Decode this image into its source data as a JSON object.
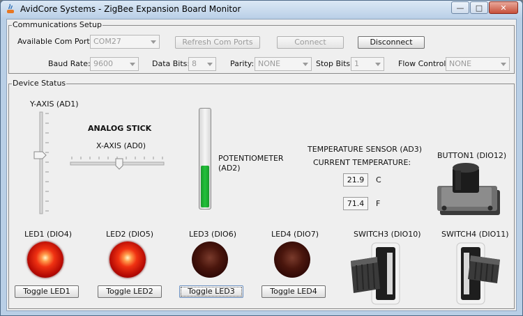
{
  "window": {
    "title": "AvidCore Systems - ZigBee Expansion Board Monitor"
  },
  "comms": {
    "group_title": "Communications Setup",
    "ports_label": "Available Com Ports:",
    "port_value": "COM27",
    "refresh_label": "Refresh Com Ports",
    "connect_label": "Connect",
    "disconnect_label": "Disconnect",
    "baud_label": "Baud Rate:",
    "baud_value": "9600",
    "databits_label": "Data Bits:",
    "databits_value": "8",
    "parity_label": "Parity:",
    "parity_value": "NONE",
    "stopbits_label": "Stop Bits:",
    "stopbits_value": "1",
    "flow_label": "Flow Control:",
    "flow_value": "NONE"
  },
  "device": {
    "group_title": "Device Status",
    "y_axis_label": "Y-AXIS (AD1)",
    "analog_stick_label": "ANALOG STICK",
    "x_axis_label": "X-AXIS (AD0)",
    "potentiometer_label_1": "POTENTIOMETER",
    "potentiometer_label_2": "(AD2)",
    "potentiometer_level": 0.42,
    "temp_sensor_label": "TEMPERATURE SENSOR (AD3)",
    "current_temp_label": "CURRENT TEMPERATURE:",
    "temp_c": "21.9",
    "temp_c_unit": "C",
    "temp_f": "71.4",
    "temp_f_unit": "F",
    "button1_label": "BUTTON1 (DIO12)",
    "leds": [
      {
        "label": "LED1 (DIO4)",
        "button": "Toggle LED1",
        "state": "on"
      },
      {
        "label": "LED2 (DIO5)",
        "button": "Toggle LED2",
        "state": "on"
      },
      {
        "label": "LED3 (DIO6)",
        "button": "Toggle LED3",
        "state": "off"
      },
      {
        "label": "LED4 (DIO7)",
        "button": "Toggle LED4",
        "state": "off"
      }
    ],
    "switch3_label": "SWITCH3 (DIO10)",
    "switch4_label": "SWITCH4 (DIO11)"
  },
  "colors": {
    "pot_fill": "#22c23a",
    "led_on": "#e62a10",
    "led_off": "#3a0a06"
  }
}
